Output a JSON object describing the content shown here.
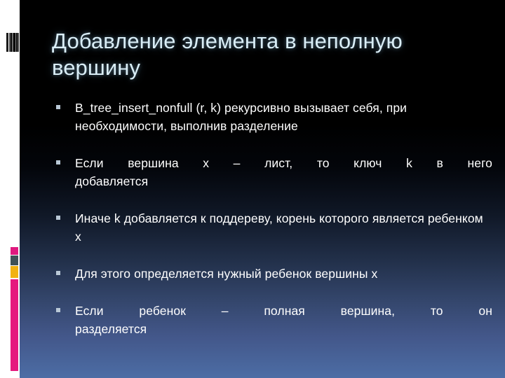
{
  "slide": {
    "title": "Добавление элемента в неполную вершину",
    "bullets": [
      {
        "marker": "square-bullet-icon",
        "text": "B_tree_insert_nonfull (r, k) рекурсивно вызывает себя, при необходимости, выполнив разделение",
        "line1": "B_tree_insert_nonfull (r, k) рекурсивно вызывает",
        "line2": "себя, при необходимости, выполнив разделение",
        "justified": false
      },
      {
        "marker": "square-bullet-icon",
        "text": "Если вершина x – лист, то ключ k в него добавляется",
        "line1": "Если вершина x – лист, то ключ k в него",
        "line2": "добавляется",
        "justified": true
      },
      {
        "marker": "square-bullet-icon",
        "text": "Иначе k добавляется к поддереву, корень которого является ребенком x",
        "line1": "Иначе k добавляется к поддереву, корень которого",
        "line2": "является ребенком x",
        "justified": false
      },
      {
        "marker": "square-bullet-icon",
        "text": "Для этого определяется нужный ребенок вершины x",
        "line1": "Для этого определяется нужный ребенок вершины",
        "line2": "x",
        "justified": false
      },
      {
        "marker": "square-bullet-icon",
        "text": "Если ребенок – полная вершина, то он разделяется",
        "line1": "Если ребенок – полная вершина, то он",
        "line2": "разделяется",
        "justified": true
      }
    ]
  },
  "decor": {
    "barcode_bars": [
      {
        "color": "#1a1a1a",
        "width": 3
      },
      {
        "color": "#ffffff",
        "width": 1
      },
      {
        "color": "#555555",
        "width": 2
      },
      {
        "color": "#0d0d0d",
        "width": 2
      },
      {
        "color": "#6e6e6e",
        "width": 2
      },
      {
        "color": "#000000",
        "width": 3
      },
      {
        "color": "#8a8a8a",
        "width": 1
      },
      {
        "color": "#111111",
        "width": 2
      },
      {
        "color": "#4a4a4a",
        "width": 2
      }
    ],
    "chip_pink": "#e0197f",
    "chip_teal": "#3f5257",
    "chip_gold": "#f2b212",
    "rule_magenta": "#e5197e"
  },
  "colors": {
    "title": "#d9edf6",
    "body_text": "#ffffff",
    "bullet_marker": "#b9c8d6",
    "background_top": "#000000",
    "background_bottom": "#4c6da5",
    "left_strip": "#ffffff"
  }
}
